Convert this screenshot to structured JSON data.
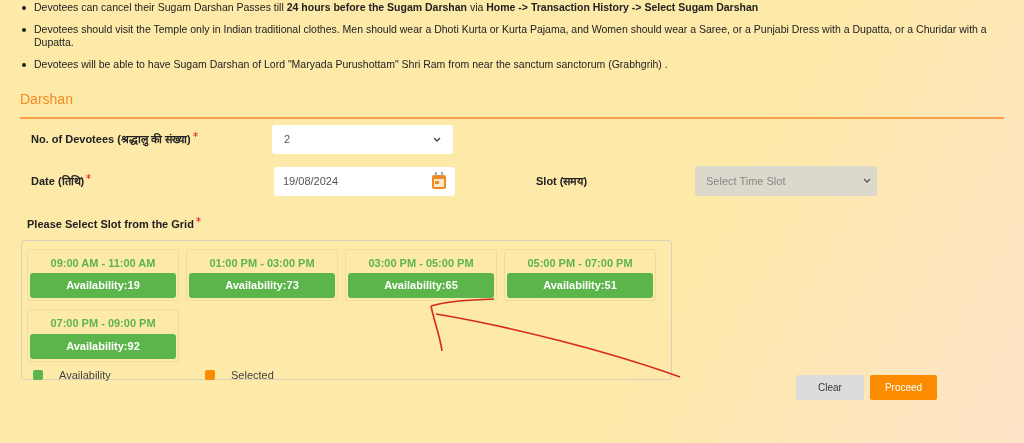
{
  "notes": [
    "Devotees can cancel their Sugam Darshan Passes till **24 hours before the Sugam Darshan** via **Home -> Transaction History -> Select Sugam Darshan**",
    "Devotees should visit the Temple only in Indian traditional clothes. Men should wear a Dhoti Kurta or Kurta Pajama, and Women should wear a Saree, or a Punjabi Dress with a Dupatta, or a Churidar with a Dupatta.",
    "Devotees will be able to have Sugam Darshan of Lord \"Maryada Purushottam\" Shri Ram from near the sanctum sanctorum (Grabhgrih) ."
  ],
  "section": {
    "title": "Darshan"
  },
  "devotees": {
    "label": "No. of Devotees (श्रद्धालु की संख्या)",
    "required": true,
    "value": "2"
  },
  "date": {
    "label": "Date (तिथि)",
    "required": true,
    "value": "19/08/2024"
  },
  "slot": {
    "label": "Slot (समय)",
    "placeholder": "Select Time Slot",
    "disabled": true
  },
  "grid": {
    "label": "Please Select Slot from the Grid",
    "required": true,
    "slots": [
      {
        "time": "09:00 AM - 11:00 AM",
        "availability": "Availability:19",
        "selected": false
      },
      {
        "time": "01:00 PM - 03:00 PM",
        "availability": "Availability:73",
        "selected": false
      },
      {
        "time": "03:00 PM - 05:00 PM",
        "availability": "Availability:65",
        "selected": false
      },
      {
        "time": "05:00 PM - 07:00 PM",
        "availability": "Availability:51",
        "selected": false
      },
      {
        "time": "07:00 PM - 09:00 PM",
        "availability": "Availability:92",
        "selected": false
      }
    ],
    "legend": [
      {
        "label": "Availability",
        "color": "#5cb54a"
      },
      {
        "label": "Selected",
        "color": "#fb8c00"
      }
    ]
  },
  "buttons": [
    {
      "label": "Clear",
      "kind": "secondary"
    },
    {
      "label": "Proceed",
      "kind": "primary"
    }
  ]
}
